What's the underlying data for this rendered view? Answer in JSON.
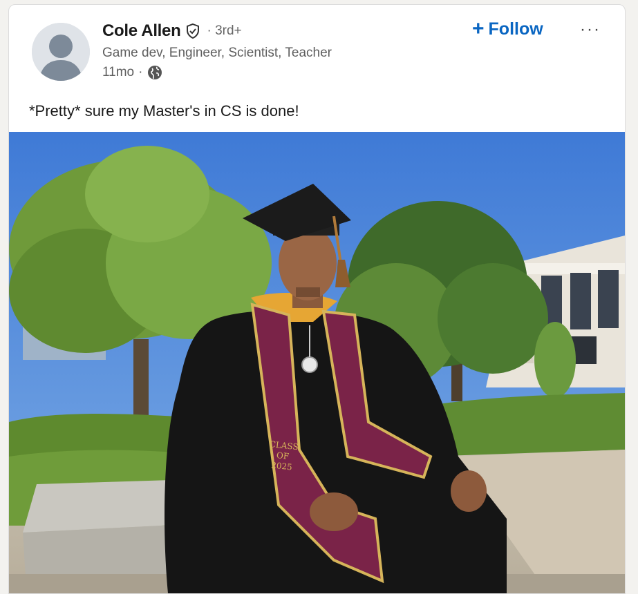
{
  "post": {
    "author": {
      "name": "Cole Allen",
      "badge_icon": "verified-shield-icon",
      "degree": "· 3rd+",
      "headline": "Game dev, Engineer, Scientist, Teacher",
      "time": "11mo",
      "separator": "·",
      "visibility_icon": "globe-icon"
    },
    "follow_plus": "+",
    "follow_label": "Follow",
    "more_label": "···",
    "commentary": "*Pretty* sure my Master's in CS is done!",
    "photo": {
      "sash_text": [
        "CLASS",
        "OF",
        "2025"
      ]
    }
  },
  "colors": {
    "accent": "#0a66c2",
    "sky": "#4a86d8",
    "gown": "#141414",
    "sash": "#7a2348",
    "sash_trim": "#d6b45a"
  }
}
